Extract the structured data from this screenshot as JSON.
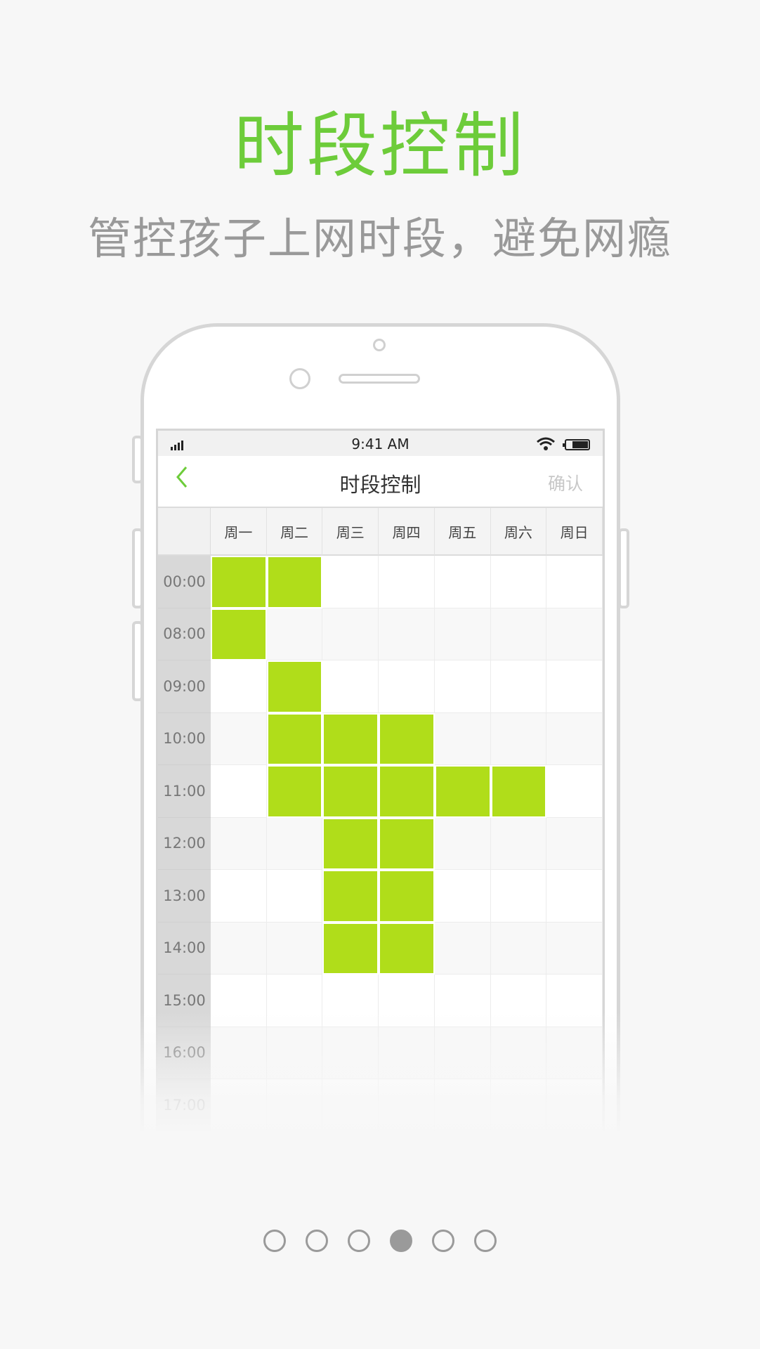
{
  "hero": {
    "title": "时段控制",
    "subtitle": "管控孩子上网时段，避免网瘾"
  },
  "status_bar": {
    "time": "9:41 AM",
    "icons": [
      "signal-icon",
      "wifi-icon",
      "battery-icon"
    ]
  },
  "nav": {
    "back_icon": "chevron-left-icon",
    "title": "时段控制",
    "confirm_label": "确认"
  },
  "schedule": {
    "days": [
      "周一",
      "周二",
      "周三",
      "周四",
      "周五",
      "周六",
      "周日"
    ],
    "times": [
      "00:00",
      "08:00",
      "09:00",
      "10:00",
      "11:00",
      "12:00",
      "13:00",
      "14:00",
      "15:00",
      "16:00",
      "17:00"
    ],
    "selected": [
      [
        1,
        1,
        0,
        0,
        0,
        0,
        0
      ],
      [
        1,
        0,
        0,
        0,
        0,
        0,
        0
      ],
      [
        0,
        1,
        0,
        0,
        0,
        0,
        0
      ],
      [
        0,
        1,
        1,
        1,
        0,
        0,
        0
      ],
      [
        0,
        1,
        1,
        1,
        1,
        1,
        0
      ],
      [
        0,
        0,
        1,
        1,
        0,
        0,
        0
      ],
      [
        0,
        0,
        1,
        1,
        0,
        0,
        0
      ],
      [
        0,
        0,
        1,
        1,
        0,
        0,
        0
      ],
      [
        0,
        0,
        0,
        0,
        0,
        0,
        0
      ],
      [
        0,
        0,
        0,
        0,
        0,
        0,
        0
      ],
      [
        0,
        0,
        0,
        0,
        0,
        0,
        0
      ]
    ]
  },
  "pagination": {
    "count": 6,
    "active": 3
  },
  "colors": {
    "accent": "#6dcc3a",
    "selected_cell": "#b0dd1a",
    "subtitle": "#999999",
    "background": "#f7f7f7"
  }
}
